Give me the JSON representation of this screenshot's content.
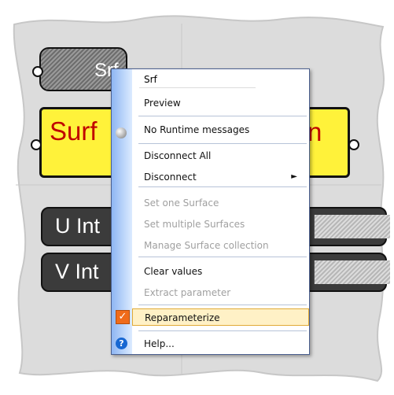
{
  "canvas": {
    "background_nodes": {
      "surface_parameter_label": "Srf",
      "surface_node_left_text": "Surf",
      "surface_node_right_text": "n",
      "u_slider_label": "U Int",
      "v_slider_label": "V Int"
    }
  },
  "context_menu": {
    "name_field_value": "Srf",
    "items": [
      {
        "label": "Preview",
        "enabled": true
      },
      {
        "label": "No Runtime messages",
        "enabled": true,
        "icon": "radio-icon"
      },
      {
        "label": "Disconnect All",
        "enabled": true
      },
      {
        "label": "Disconnect",
        "enabled": true,
        "submenu": true
      },
      {
        "label": "Set one Surface",
        "enabled": false
      },
      {
        "label": "Set multiple Surfaces",
        "enabled": false
      },
      {
        "label": "Manage Surface collection",
        "enabled": false
      },
      {
        "label": "Clear values",
        "enabled": true
      },
      {
        "label": "Extract parameter",
        "enabled": false
      },
      {
        "label": "Reparameterize",
        "enabled": true,
        "checked": true,
        "highlighted": true
      },
      {
        "label": "Help...",
        "enabled": true,
        "icon": "help-icon"
      }
    ],
    "submenu_arrow": "►",
    "check_mark": "✓",
    "help_symbol": "?"
  },
  "colors": {
    "menu_border": "#4a5f8e",
    "menu_gutter": "#8eb6f3",
    "highlight": "#fff1c6",
    "check_orange": "#f06b1a",
    "node_yellow": "#fff23a",
    "node_text_red": "#c00000"
  }
}
